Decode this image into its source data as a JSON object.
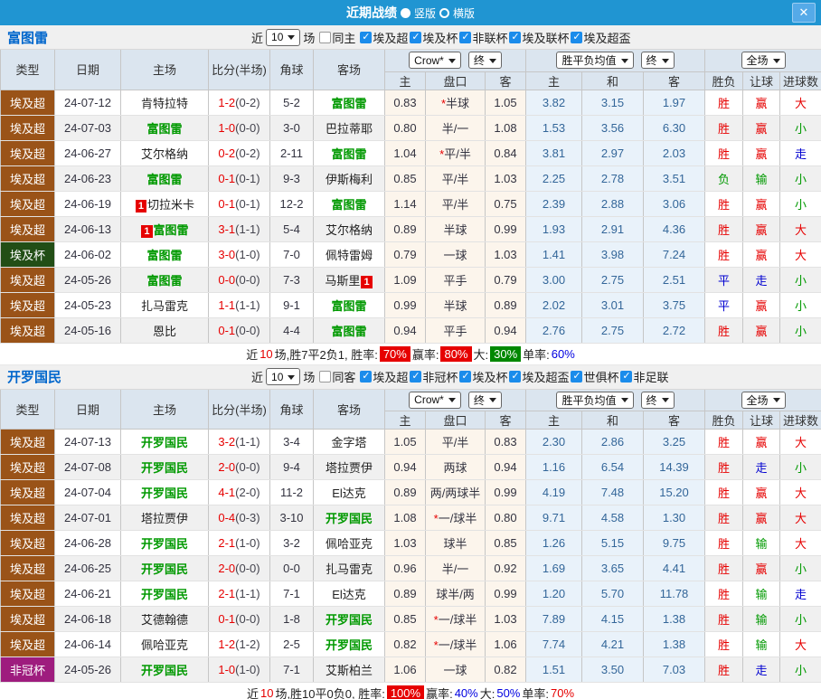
{
  "title_bar": {
    "title": "近期战绩",
    "close_icon": "✕",
    "layout_options": [
      {
        "label": "竖版",
        "selected": true
      },
      {
        "label": "横版",
        "selected": false
      }
    ]
  },
  "colors": {
    "titlebar": "#2095d2",
    "accent_blue": "#0066cc",
    "team_green": "#009900",
    "score_red": "#e60000",
    "avg_blue": "#336699"
  },
  "type_colors": {
    "埃及超": "#9a5318",
    "埃及杯": "#224e16",
    "非冠杯": "#9e1c7e"
  },
  "value_colors": {
    "胜": "#e60000",
    "赢": "#e60000",
    "大": "#e60000",
    "平": "#0000d0",
    "走": "#0000d0",
    "负": "#009900",
    "输": "#009900",
    "小": "#009900"
  },
  "table_header": {
    "cols": [
      "类型",
      "日期",
      "主场",
      "比分(半场)",
      "角球",
      "客场"
    ],
    "sub": [
      "主",
      "盘口",
      "客",
      "主",
      "和",
      "客",
      "胜负",
      "让球",
      "进球数"
    ],
    "selects": {
      "crow": "Crow*",
      "final1": "终",
      "avg": "胜平负均值",
      "final2": "终",
      "fullmatch": "全场"
    }
  },
  "sections": [
    {
      "team": "富图雷",
      "filter": {
        "near_label": "近",
        "count": "10",
        "games_label": "场",
        "same_label": "同主",
        "same_checked": false,
        "leagues": [
          {
            "label": "埃及超",
            "checked": true
          },
          {
            "label": "埃及杯",
            "checked": true
          },
          {
            "label": "非联杯",
            "checked": true
          },
          {
            "label": "埃及联杯",
            "checked": true
          },
          {
            "label": "埃及超盃",
            "checked": true
          }
        ]
      },
      "rows": [
        {
          "type": "埃及超",
          "date": "24-07-12",
          "home": {
            "name": "肯特拉特",
            "green": false
          },
          "score": {
            "ft": "1-2",
            "ht": "(0-2)"
          },
          "corner": "5-2",
          "away": {
            "name": "富图雷",
            "green": true
          },
          "odds": {
            "home": "0.83",
            "handicap": "*半球",
            "away": "1.05"
          },
          "avg": {
            "win": "3.82",
            "draw": "3.15",
            "lose": "1.97"
          },
          "results": {
            "wdl": "胜",
            "asian": "赢",
            "goals": "大"
          }
        },
        {
          "type": "埃及超",
          "date": "24-07-03",
          "home": {
            "name": "富图雷",
            "green": true
          },
          "score": {
            "ft": "1-0",
            "ht": "(0-0)"
          },
          "corner": "3-0",
          "away": {
            "name": "巴拉蒂耶",
            "green": false
          },
          "odds": {
            "home": "0.80",
            "handicap": "半/一",
            "away": "1.08"
          },
          "avg": {
            "win": "1.53",
            "draw": "3.56",
            "lose": "6.30"
          },
          "results": {
            "wdl": "胜",
            "asian": "赢",
            "goals": "小"
          }
        },
        {
          "type": "埃及超",
          "date": "24-06-27",
          "home": {
            "name": "艾尔格纳",
            "green": false
          },
          "score": {
            "ft": "0-2",
            "ht": "(0-2)"
          },
          "corner": "2-11",
          "away": {
            "name": "富图雷",
            "green": true
          },
          "odds": {
            "home": "1.04",
            "handicap": "*平/半",
            "away": "0.84"
          },
          "avg": {
            "win": "3.81",
            "draw": "2.97",
            "lose": "2.03"
          },
          "results": {
            "wdl": "胜",
            "asian": "赢",
            "goals": "走"
          }
        },
        {
          "type": "埃及超",
          "date": "24-06-23",
          "home": {
            "name": "富图雷",
            "green": true
          },
          "score": {
            "ft": "0-1",
            "ht": "(0-1)"
          },
          "corner": "9-3",
          "away": {
            "name": "伊斯梅利",
            "green": false
          },
          "odds": {
            "home": "0.85",
            "handicap": "平/半",
            "away": "1.03"
          },
          "avg": {
            "win": "2.25",
            "draw": "2.78",
            "lose": "3.51"
          },
          "results": {
            "wdl": "负",
            "asian": "输",
            "goals": "小"
          }
        },
        {
          "type": "埃及超",
          "date": "24-06-19",
          "home": {
            "name": "切拉米卡",
            "green": false,
            "badge": "1",
            "badge_pos": "before"
          },
          "score": {
            "ft": "0-1",
            "ht": "(0-1)"
          },
          "corner": "12-2",
          "away": {
            "name": "富图雷",
            "green": true
          },
          "odds": {
            "home": "1.14",
            "handicap": "平/半",
            "away": "0.75"
          },
          "avg": {
            "win": "2.39",
            "draw": "2.88",
            "lose": "3.06"
          },
          "results": {
            "wdl": "胜",
            "asian": "赢",
            "goals": "小"
          }
        },
        {
          "type": "埃及超",
          "date": "24-06-13",
          "home": {
            "name": "富图雷",
            "green": true,
            "badge": "1",
            "badge_pos": "before"
          },
          "score": {
            "ft": "3-1",
            "ht": "(1-1)"
          },
          "corner": "5-4",
          "away": {
            "name": "艾尔格纳",
            "green": false
          },
          "odds": {
            "home": "0.89",
            "handicap": "半球",
            "away": "0.99"
          },
          "avg": {
            "win": "1.93",
            "draw": "2.91",
            "lose": "4.36"
          },
          "results": {
            "wdl": "胜",
            "asian": "赢",
            "goals": "大"
          }
        },
        {
          "type": "埃及杯",
          "date": "24-06-02",
          "home": {
            "name": "富图雷",
            "green": true
          },
          "score": {
            "ft": "3-0",
            "ht": "(1-0)"
          },
          "corner": "7-0",
          "away": {
            "name": "佩特雷姆",
            "green": false
          },
          "odds": {
            "home": "0.79",
            "handicap": "一球",
            "away": "1.03"
          },
          "avg": {
            "win": "1.41",
            "draw": "3.98",
            "lose": "7.24"
          },
          "results": {
            "wdl": "胜",
            "asian": "赢",
            "goals": "大"
          }
        },
        {
          "type": "埃及超",
          "date": "24-05-26",
          "home": {
            "name": "富图雷",
            "green": true
          },
          "score": {
            "ft": "0-0",
            "ht": "(0-0)"
          },
          "corner": "7-3",
          "away": {
            "name": "马斯里",
            "green": false,
            "badge": "1",
            "badge_pos": "after"
          },
          "odds": {
            "home": "1.09",
            "handicap": "平手",
            "away": "0.79"
          },
          "avg": {
            "win": "3.00",
            "draw": "2.75",
            "lose": "2.51"
          },
          "results": {
            "wdl": "平",
            "asian": "走",
            "goals": "小"
          }
        },
        {
          "type": "埃及超",
          "date": "24-05-23",
          "home": {
            "name": "扎马雷克",
            "green": false
          },
          "score": {
            "ft": "1-1",
            "ht": "(1-1)"
          },
          "corner": "9-1",
          "away": {
            "name": "富图雷",
            "green": true
          },
          "odds": {
            "home": "0.99",
            "handicap": "半球",
            "away": "0.89"
          },
          "avg": {
            "win": "2.02",
            "draw": "3.01",
            "lose": "3.75"
          },
          "results": {
            "wdl": "平",
            "asian": "赢",
            "goals": "小"
          }
        },
        {
          "type": "埃及超",
          "date": "24-05-16",
          "home": {
            "name": "恩比",
            "green": false
          },
          "score": {
            "ft": "0-1",
            "ht": "(0-0)"
          },
          "corner": "4-4",
          "away": {
            "name": "富图雷",
            "green": true
          },
          "odds": {
            "home": "0.94",
            "handicap": "平手",
            "away": "0.94"
          },
          "avg": {
            "win": "2.76",
            "draw": "2.75",
            "lose": "2.72"
          },
          "results": {
            "wdl": "胜",
            "asian": "赢",
            "goals": "小"
          }
        }
      ],
      "summary": [
        {
          "text": "近",
          "style": "plain"
        },
        {
          "text": "10",
          "style": "red-text"
        },
        {
          "text": "场,胜7平2负1, 胜率:",
          "style": "plain"
        },
        {
          "text": "70%",
          "style": "red-bg"
        },
        {
          "text": " 赢率:",
          "style": "plain"
        },
        {
          "text": "80%",
          "style": "red-bg"
        },
        {
          "text": " 大:",
          "style": "plain"
        },
        {
          "text": "30%",
          "style": "green-bg"
        },
        {
          "text": " 单率:",
          "style": "plain"
        },
        {
          "text": "60%",
          "style": "blue-text"
        }
      ]
    },
    {
      "team": "开罗国民",
      "filter": {
        "near_label": "近",
        "count": "10",
        "games_label": "场",
        "same_label": "同客",
        "same_checked": false,
        "leagues": [
          {
            "label": "埃及超",
            "checked": true
          },
          {
            "label": "非冠杯",
            "checked": true
          },
          {
            "label": "埃及杯",
            "checked": true
          },
          {
            "label": "埃及超盃",
            "checked": true
          },
          {
            "label": "世俱杯",
            "checked": true
          },
          {
            "label": "非足联",
            "checked": true
          }
        ]
      },
      "rows": [
        {
          "type": "埃及超",
          "date": "24-07-13",
          "home": {
            "name": "开罗国民",
            "green": true
          },
          "score": {
            "ft": "3-2",
            "ht": "(1-1)"
          },
          "corner": "3-4",
          "away": {
            "name": "金字塔",
            "green": false
          },
          "odds": {
            "home": "1.05",
            "handicap": "平/半",
            "away": "0.83"
          },
          "avg": {
            "win": "2.30",
            "draw": "2.86",
            "lose": "3.25"
          },
          "results": {
            "wdl": "胜",
            "asian": "赢",
            "goals": "大"
          }
        },
        {
          "type": "埃及超",
          "date": "24-07-08",
          "home": {
            "name": "开罗国民",
            "green": true
          },
          "score": {
            "ft": "2-0",
            "ht": "(0-0)"
          },
          "corner": "9-4",
          "away": {
            "name": "塔拉贾伊",
            "green": false
          },
          "odds": {
            "home": "0.94",
            "handicap": "两球",
            "away": "0.94"
          },
          "avg": {
            "win": "1.16",
            "draw": "6.54",
            "lose": "14.39"
          },
          "results": {
            "wdl": "胜",
            "asian": "走",
            "goals": "小"
          }
        },
        {
          "type": "埃及超",
          "date": "24-07-04",
          "home": {
            "name": "开罗国民",
            "green": true
          },
          "score": {
            "ft": "4-1",
            "ht": "(2-0)"
          },
          "corner": "11-2",
          "away": {
            "name": "El达克",
            "green": false
          },
          "odds": {
            "home": "0.89",
            "handicap": "两/两球半",
            "away": "0.99"
          },
          "avg": {
            "win": "4.19",
            "draw": "7.48",
            "lose": "15.20"
          },
          "results": {
            "wdl": "胜",
            "asian": "赢",
            "goals": "大"
          }
        },
        {
          "type": "埃及超",
          "date": "24-07-01",
          "home": {
            "name": "塔拉贾伊",
            "green": false
          },
          "score": {
            "ft": "0-4",
            "ht": "(0-3)"
          },
          "corner": "3-10",
          "away": {
            "name": "开罗国民",
            "green": true
          },
          "odds": {
            "home": "1.08",
            "handicap": "*一/球半",
            "away": "0.80"
          },
          "avg": {
            "win": "9.71",
            "draw": "4.58",
            "lose": "1.30"
          },
          "results": {
            "wdl": "胜",
            "asian": "赢",
            "goals": "大"
          }
        },
        {
          "type": "埃及超",
          "date": "24-06-28",
          "home": {
            "name": "开罗国民",
            "green": true
          },
          "score": {
            "ft": "2-1",
            "ht": "(1-0)"
          },
          "corner": "3-2",
          "away": {
            "name": "佩哈亚克",
            "green": false
          },
          "odds": {
            "home": "1.03",
            "handicap": "球半",
            "away": "0.85"
          },
          "avg": {
            "win": "1.26",
            "draw": "5.15",
            "lose": "9.75"
          },
          "results": {
            "wdl": "胜",
            "asian": "输",
            "goals": "大"
          }
        },
        {
          "type": "埃及超",
          "date": "24-06-25",
          "home": {
            "name": "开罗国民",
            "green": true
          },
          "score": {
            "ft": "2-0",
            "ht": "(0-0)"
          },
          "corner": "0-0",
          "away": {
            "name": "扎马雷克",
            "green": false
          },
          "odds": {
            "home": "0.96",
            "handicap": "半/一",
            "away": "0.92"
          },
          "avg": {
            "win": "1.69",
            "draw": "3.65",
            "lose": "4.41"
          },
          "results": {
            "wdl": "胜",
            "asian": "赢",
            "goals": "小"
          }
        },
        {
          "type": "埃及超",
          "date": "24-06-21",
          "home": {
            "name": "开罗国民",
            "green": true
          },
          "score": {
            "ft": "2-1",
            "ht": "(1-1)"
          },
          "corner": "7-1",
          "away": {
            "name": "El达克",
            "green": false
          },
          "odds": {
            "home": "0.89",
            "handicap": "球半/两",
            "away": "0.99"
          },
          "avg": {
            "win": "1.20",
            "draw": "5.70",
            "lose": "11.78"
          },
          "results": {
            "wdl": "胜",
            "asian": "输",
            "goals": "走"
          }
        },
        {
          "type": "埃及超",
          "date": "24-06-18",
          "home": {
            "name": "艾德翰德",
            "green": false
          },
          "score": {
            "ft": "0-1",
            "ht": "(0-0)"
          },
          "corner": "1-8",
          "away": {
            "name": "开罗国民",
            "green": true
          },
          "odds": {
            "home": "0.85",
            "handicap": "*一/球半",
            "away": "1.03"
          },
          "avg": {
            "win": "7.89",
            "draw": "4.15",
            "lose": "1.38"
          },
          "results": {
            "wdl": "胜",
            "asian": "输",
            "goals": "小"
          }
        },
        {
          "type": "埃及超",
          "date": "24-06-14",
          "home": {
            "name": "佩哈亚克",
            "green": false
          },
          "score": {
            "ft": "1-2",
            "ht": "(1-2)"
          },
          "corner": "2-5",
          "away": {
            "name": "开罗国民",
            "green": true
          },
          "odds": {
            "home": "0.82",
            "handicap": "*一/球半",
            "away": "1.06"
          },
          "avg": {
            "win": "7.74",
            "draw": "4.21",
            "lose": "1.38"
          },
          "results": {
            "wdl": "胜",
            "asian": "输",
            "goals": "大"
          }
        },
        {
          "type": "非冠杯",
          "date": "24-05-26",
          "home": {
            "name": "开罗国民",
            "green": true
          },
          "score": {
            "ft": "1-0",
            "ht": "(1-0)"
          },
          "corner": "7-1",
          "away": {
            "name": "艾斯柏兰",
            "green": false
          },
          "odds": {
            "home": "1.06",
            "handicap": "一球",
            "away": "0.82"
          },
          "avg": {
            "win": "1.51",
            "draw": "3.50",
            "lose": "7.03"
          },
          "results": {
            "wdl": "胜",
            "asian": "走",
            "goals": "小"
          }
        }
      ],
      "summary": [
        {
          "text": "近",
          "style": "plain"
        },
        {
          "text": "10",
          "style": "red-text"
        },
        {
          "text": "场,胜10平0负0, 胜率:",
          "style": "plain"
        },
        {
          "text": "100%",
          "style": "red-bg"
        },
        {
          "text": " 赢率:",
          "style": "plain"
        },
        {
          "text": "40%",
          "style": "blue-text"
        },
        {
          "text": " 大:",
          "style": "plain"
        },
        {
          "text": "50%",
          "style": "blue-text"
        },
        {
          "text": " 单率:",
          "style": "plain"
        },
        {
          "text": "70%",
          "style": "red-text"
        }
      ]
    }
  ]
}
